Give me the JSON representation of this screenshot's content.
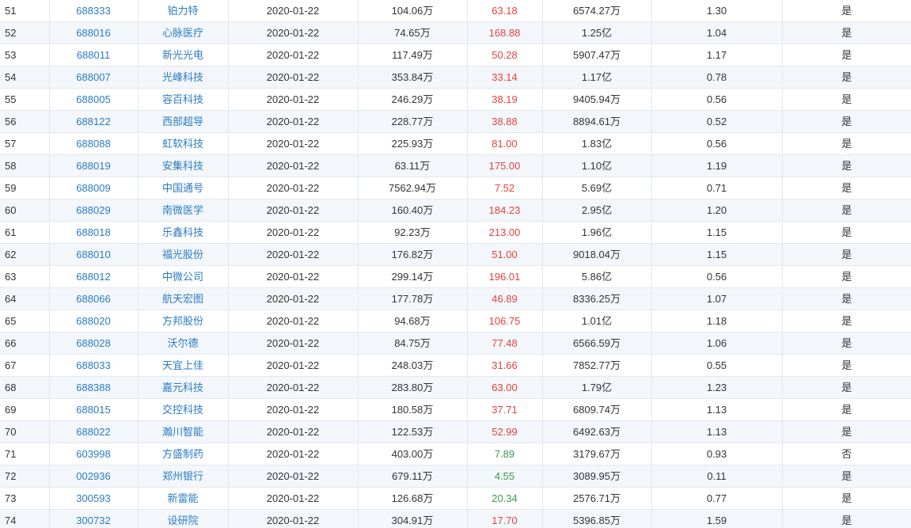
{
  "colors": {
    "link": "#2a7bc4",
    "price_up": "#e5413e",
    "price_down": "#3a9a4a",
    "row_alt": "#f3f7fb",
    "border": "#e3e8ee"
  },
  "rows": [
    {
      "index": "51",
      "code": "688333",
      "name": "铂力特",
      "date": "2020-01-22",
      "volume": "104.06万",
      "price": "63.18",
      "trend": "up",
      "market_cap": "6574.27万",
      "ratio": "1.30",
      "flag": "是"
    },
    {
      "index": "52",
      "code": "688016",
      "name": "心脉医疗",
      "date": "2020-01-22",
      "volume": "74.65万",
      "price": "168.88",
      "trend": "up",
      "market_cap": "1.25亿",
      "ratio": "1.04",
      "flag": "是"
    },
    {
      "index": "53",
      "code": "688011",
      "name": "新光光电",
      "date": "2020-01-22",
      "volume": "117.49万",
      "price": "50.28",
      "trend": "up",
      "market_cap": "5907.47万",
      "ratio": "1.17",
      "flag": "是"
    },
    {
      "index": "54",
      "code": "688007",
      "name": "光峰科技",
      "date": "2020-01-22",
      "volume": "353.84万",
      "price": "33.14",
      "trend": "up",
      "market_cap": "1.17亿",
      "ratio": "0.78",
      "flag": "是"
    },
    {
      "index": "55",
      "code": "688005",
      "name": "容百科技",
      "date": "2020-01-22",
      "volume": "246.29万",
      "price": "38.19",
      "trend": "up",
      "market_cap": "9405.94万",
      "ratio": "0.56",
      "flag": "是"
    },
    {
      "index": "56",
      "code": "688122",
      "name": "西部超导",
      "date": "2020-01-22",
      "volume": "228.77万",
      "price": "38.88",
      "trend": "up",
      "market_cap": "8894.61万",
      "ratio": "0.52",
      "flag": "是"
    },
    {
      "index": "57",
      "code": "688088",
      "name": "虹软科技",
      "date": "2020-01-22",
      "volume": "225.93万",
      "price": "81.00",
      "trend": "up",
      "market_cap": "1.83亿",
      "ratio": "0.56",
      "flag": "是"
    },
    {
      "index": "58",
      "code": "688019",
      "name": "安集科技",
      "date": "2020-01-22",
      "volume": "63.11万",
      "price": "175.00",
      "trend": "up",
      "market_cap": "1.10亿",
      "ratio": "1.19",
      "flag": "是"
    },
    {
      "index": "59",
      "code": "688009",
      "name": "中国通号",
      "date": "2020-01-22",
      "volume": "7562.94万",
      "price": "7.52",
      "trend": "up",
      "market_cap": "5.69亿",
      "ratio": "0.71",
      "flag": "是"
    },
    {
      "index": "60",
      "code": "688029",
      "name": "南微医学",
      "date": "2020-01-22",
      "volume": "160.40万",
      "price": "184.23",
      "trend": "up",
      "market_cap": "2.95亿",
      "ratio": "1.20",
      "flag": "是"
    },
    {
      "index": "61",
      "code": "688018",
      "name": "乐鑫科技",
      "date": "2020-01-22",
      "volume": "92.23万",
      "price": "213.00",
      "trend": "up",
      "market_cap": "1.96亿",
      "ratio": "1.15",
      "flag": "是"
    },
    {
      "index": "62",
      "code": "688010",
      "name": "福光股份",
      "date": "2020-01-22",
      "volume": "176.82万",
      "price": "51.00",
      "trend": "up",
      "market_cap": "9018.04万",
      "ratio": "1.15",
      "flag": "是"
    },
    {
      "index": "63",
      "code": "688012",
      "name": "中微公司",
      "date": "2020-01-22",
      "volume": "299.14万",
      "price": "196.01",
      "trend": "up",
      "market_cap": "5.86亿",
      "ratio": "0.56",
      "flag": "是"
    },
    {
      "index": "64",
      "code": "688066",
      "name": "航天宏图",
      "date": "2020-01-22",
      "volume": "177.78万",
      "price": "46.89",
      "trend": "up",
      "market_cap": "8336.25万",
      "ratio": "1.07",
      "flag": "是"
    },
    {
      "index": "65",
      "code": "688020",
      "name": "方邦股份",
      "date": "2020-01-22",
      "volume": "94.68万",
      "price": "106.75",
      "trend": "up",
      "market_cap": "1.01亿",
      "ratio": "1.18",
      "flag": "是"
    },
    {
      "index": "66",
      "code": "688028",
      "name": "沃尔德",
      "date": "2020-01-22",
      "volume": "84.75万",
      "price": "77.48",
      "trend": "up",
      "market_cap": "6566.59万",
      "ratio": "1.06",
      "flag": "是"
    },
    {
      "index": "67",
      "code": "688033",
      "name": "天宜上佳",
      "date": "2020-01-22",
      "volume": "248.03万",
      "price": "31.66",
      "trend": "up",
      "market_cap": "7852.77万",
      "ratio": "0.55",
      "flag": "是"
    },
    {
      "index": "68",
      "code": "688388",
      "name": "嘉元科技",
      "date": "2020-01-22",
      "volume": "283.80万",
      "price": "63.00",
      "trend": "up",
      "market_cap": "1.79亿",
      "ratio": "1.23",
      "flag": "是"
    },
    {
      "index": "69",
      "code": "688015",
      "name": "交控科技",
      "date": "2020-01-22",
      "volume": "180.58万",
      "price": "37.71",
      "trend": "up",
      "market_cap": "6809.74万",
      "ratio": "1.13",
      "flag": "是"
    },
    {
      "index": "70",
      "code": "688022",
      "name": "瀚川智能",
      "date": "2020-01-22",
      "volume": "122.53万",
      "price": "52.99",
      "trend": "up",
      "market_cap": "6492.63万",
      "ratio": "1.13",
      "flag": "是"
    },
    {
      "index": "71",
      "code": "603998",
      "name": "方盛制药",
      "date": "2020-01-22",
      "volume": "403.00万",
      "price": "7.89",
      "trend": "down",
      "market_cap": "3179.67万",
      "ratio": "0.93",
      "flag": "否"
    },
    {
      "index": "72",
      "code": "002936",
      "name": "郑州银行",
      "date": "2020-01-22",
      "volume": "679.11万",
      "price": "4.55",
      "trend": "down",
      "market_cap": "3089.95万",
      "ratio": "0.11",
      "flag": "是"
    },
    {
      "index": "73",
      "code": "300593",
      "name": "新雷能",
      "date": "2020-01-22",
      "volume": "126.68万",
      "price": "20.34",
      "trend": "down",
      "market_cap": "2576.71万",
      "ratio": "0.77",
      "flag": "是"
    },
    {
      "index": "74",
      "code": "300732",
      "name": "设研院",
      "date": "2020-01-22",
      "volume": "304.91万",
      "price": "17.70",
      "trend": "up",
      "market_cap": "5396.85万",
      "ratio": "1.59",
      "flag": "是"
    }
  ]
}
